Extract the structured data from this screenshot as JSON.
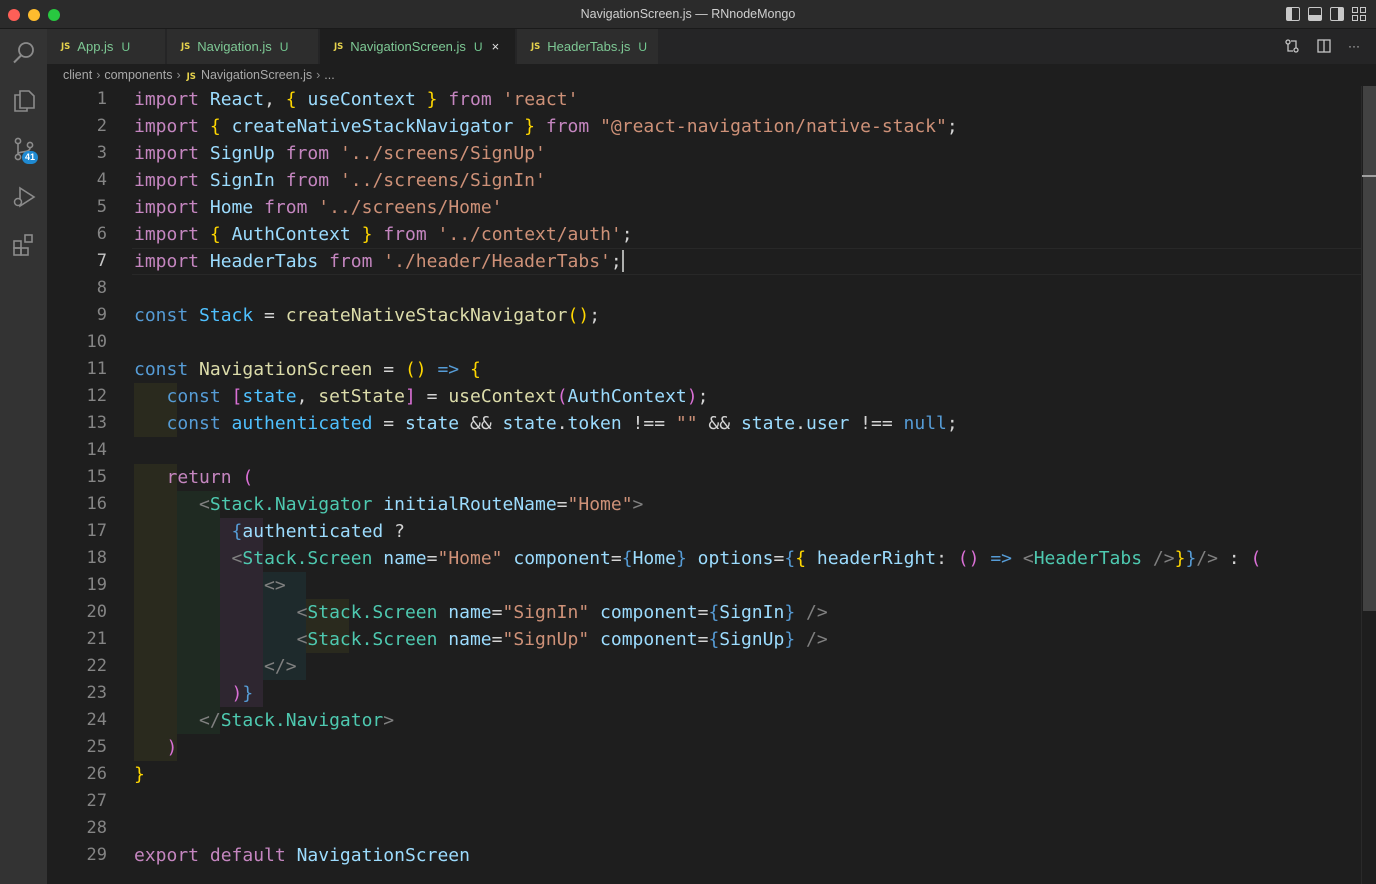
{
  "window": {
    "title": "NavigationScreen.js — RNnodeMongo"
  },
  "activity_bar": {
    "source_control_badge": "41"
  },
  "tabs": [
    {
      "label": "App.js",
      "icon": "JS",
      "status": "U"
    },
    {
      "label": "Navigation.js",
      "icon": "JS",
      "status": "U"
    },
    {
      "label": "NavigationScreen.js",
      "icon": "JS",
      "status": "U",
      "close": "×"
    },
    {
      "label": "HeaderTabs.js",
      "icon": "JS",
      "status": "U"
    }
  ],
  "tab_actions": {
    "more": "···"
  },
  "breadcrumb": {
    "items": [
      "client",
      "components"
    ],
    "file_icon": "JS",
    "file": "NavigationScreen.js",
    "tail": "..."
  },
  "editor": {
    "current_line": 7,
    "line_numbers": [
      "1",
      "2",
      "3",
      "4",
      "5",
      "6",
      "7",
      "8",
      "9",
      "10",
      "11",
      "12",
      "13",
      "14",
      "15",
      "16",
      "17",
      "18",
      "19",
      "20",
      "21",
      "22",
      "23",
      "24",
      "25",
      "26",
      "27",
      "28",
      "29"
    ]
  }
}
